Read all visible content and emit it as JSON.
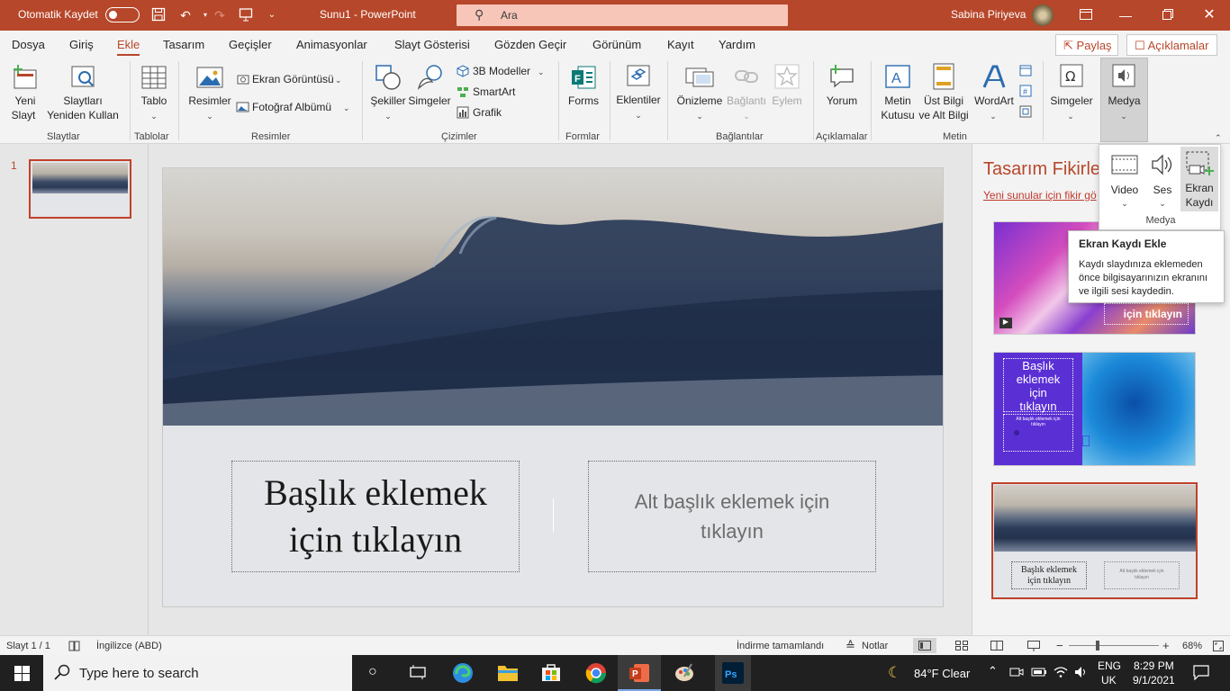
{
  "titlebar": {
    "autosave_label": "Otomatik Kaydet",
    "doc_title": "Sunu1  -  PowerPoint",
    "search_placeholder": "Ara",
    "user_name": "Sabina Piriyeva",
    "accent": "#b7472a"
  },
  "menu": {
    "tabs": [
      "Dosya",
      "Giriş",
      "Ekle",
      "Tasarım",
      "Geçişler",
      "Animasyonlar",
      "Slayt Gösterisi",
      "Gözden Geçir",
      "Görünüm",
      "Kayıt",
      "Yardım"
    ],
    "active_tab": "Ekle",
    "share_label": "Paylaş",
    "comments_label": "Açıklamalar"
  },
  "ribbon": {
    "new_slide_1": "Yeni",
    "new_slide_2": "Slayt",
    "reuse_1": "Slaytları",
    "reuse_2": "Yeniden Kullan",
    "group_slides": "Slaytlar",
    "table": "Tablo",
    "group_tables": "Tablolar",
    "pictures": "Resimler",
    "screenshot": "Ekran Görüntüsü",
    "photo_album": "Fotoğraf Albümü",
    "group_pictures": "Resimler",
    "shapes": "Şekiller",
    "icons": "Simgeler",
    "models3d": "3B Modeller",
    "smartart": "SmartArt",
    "chart": "Grafik",
    "group_illustrations": "Çizimler",
    "forms": "Forms",
    "group_forms": "Formlar",
    "addins": "Eklentiler",
    "preview": "Önizleme",
    "link": "Bağlantı",
    "action": "Eylem",
    "group_links": "Bağlantılar",
    "comment": "Yorum",
    "group_comments": "Açıklamalar",
    "textbox_1": "Metin",
    "textbox_2": "Kutusu",
    "header_1": "Üst Bilgi",
    "header_2": "ve Alt Bilgi",
    "wordart": "WordArt",
    "group_text": "Metin",
    "symbols": "Simgeler",
    "media": "Medya"
  },
  "media_popup": {
    "video": "Video",
    "audio": "Ses",
    "screen_rec_1": "Ekran",
    "screen_rec_2": "Kaydı",
    "group": "Medya"
  },
  "tooltip": {
    "title": "Ekran Kaydı Ekle",
    "body_1": "Kaydı slaydınıza eklemeden",
    "body_2": "önce bilgisayarınızın ekranını",
    "body_3": "ve ilgili sesi kaydedin."
  },
  "thumbnails": {
    "slide_number": "1"
  },
  "slide": {
    "title_1": "Başlık eklemek",
    "title_2": "için tıklayın",
    "subtitle_1": "Alt başlık eklemek için",
    "subtitle_2": "tıklayın"
  },
  "design_pane": {
    "title": "Tasarım Fikirle",
    "link": "Yeni sunular için fikir gö",
    "idea1_text": "için tıklayın",
    "idea2_title_1": "Başlık",
    "idea2_title_2": "eklemek",
    "idea2_title_3": "için",
    "idea2_title_4": "tıklayın",
    "idea2_sub_1": "Alt başlık eklemek için",
    "idea2_sub_2": "tıklayın",
    "idea3_title_1": "Başlık eklemek",
    "idea3_title_2": "için tıklayın",
    "idea3_sub_1": "Alt başlık eklemek için",
    "idea3_sub_2": "tıklayın"
  },
  "status": {
    "slide_info": "Slayt 1 / 1",
    "language": "İngilizce (ABD)",
    "download": "İndirme tamamlandı",
    "notes": "Notlar",
    "zoom": "68%"
  },
  "taskbar": {
    "search_placeholder": "Type here to search",
    "weather": "84°F  Clear",
    "lang_1": "ENG",
    "lang_2": "UK",
    "time": "8:29 PM",
    "date": "9/1/2021"
  }
}
